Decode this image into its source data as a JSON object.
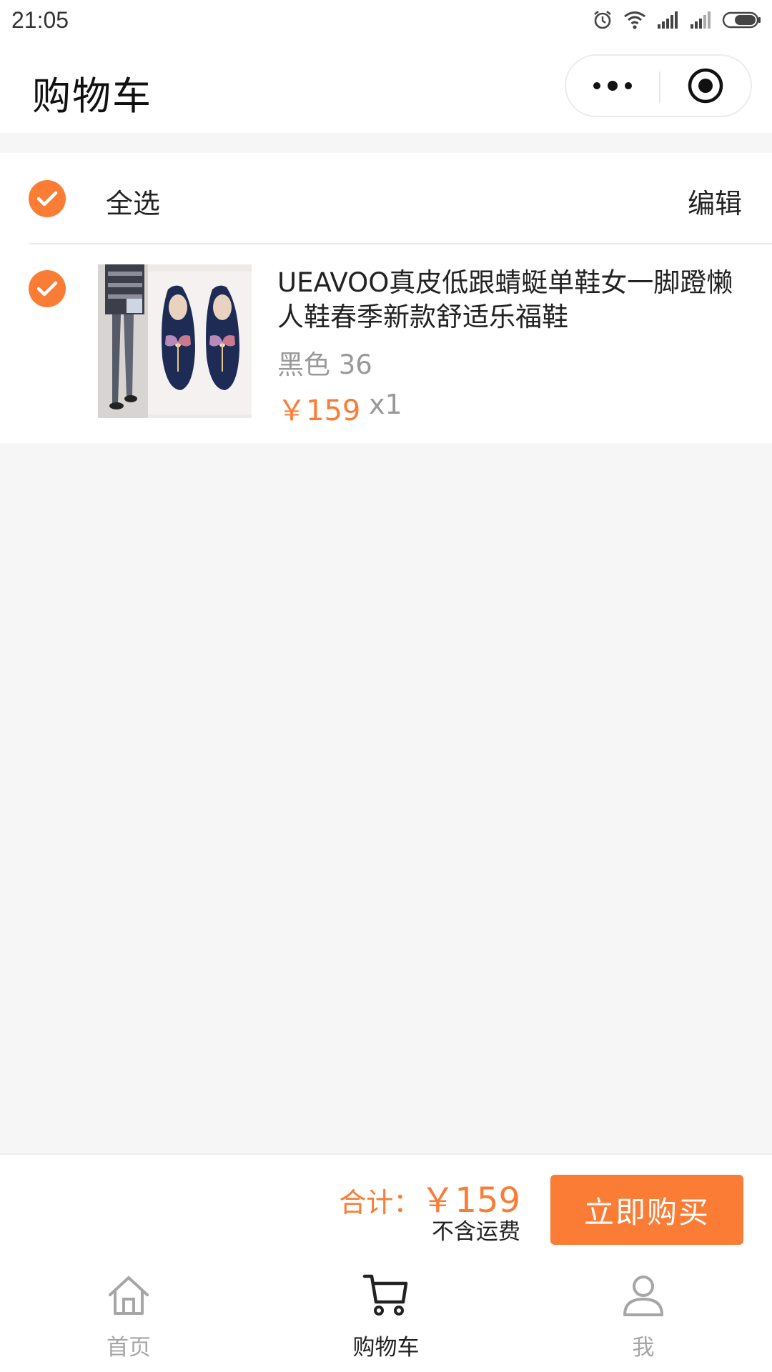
{
  "status_bar": {
    "time": "21:05"
  },
  "header": {
    "title": "购物车"
  },
  "cart": {
    "select_all_label": "全选",
    "edit_label": "编辑",
    "items": [
      {
        "title": "UEAVOO真皮低跟蜻蜓单鞋女一脚蹬懒人鞋春季新款舒适乐福鞋",
        "spec": "黑色 36",
        "price": "￥159",
        "quantity": "x1",
        "selected": true
      }
    ],
    "all_selected": true
  },
  "checkout": {
    "total_label": "合计：",
    "total_amount": "￥159",
    "shipping_note": "不含运费",
    "buy_button_label": "立即购买"
  },
  "tab_bar": {
    "tabs": [
      {
        "label": "首页",
        "icon": "home-icon",
        "active": false
      },
      {
        "label": "购物车",
        "icon": "cart-icon",
        "active": true
      },
      {
        "label": "我",
        "icon": "user-icon",
        "active": false
      }
    ]
  },
  "colors": {
    "accent": "#fa7c35",
    "background": "#f6f6f6",
    "inactive_tab": "#a6a6a6"
  }
}
